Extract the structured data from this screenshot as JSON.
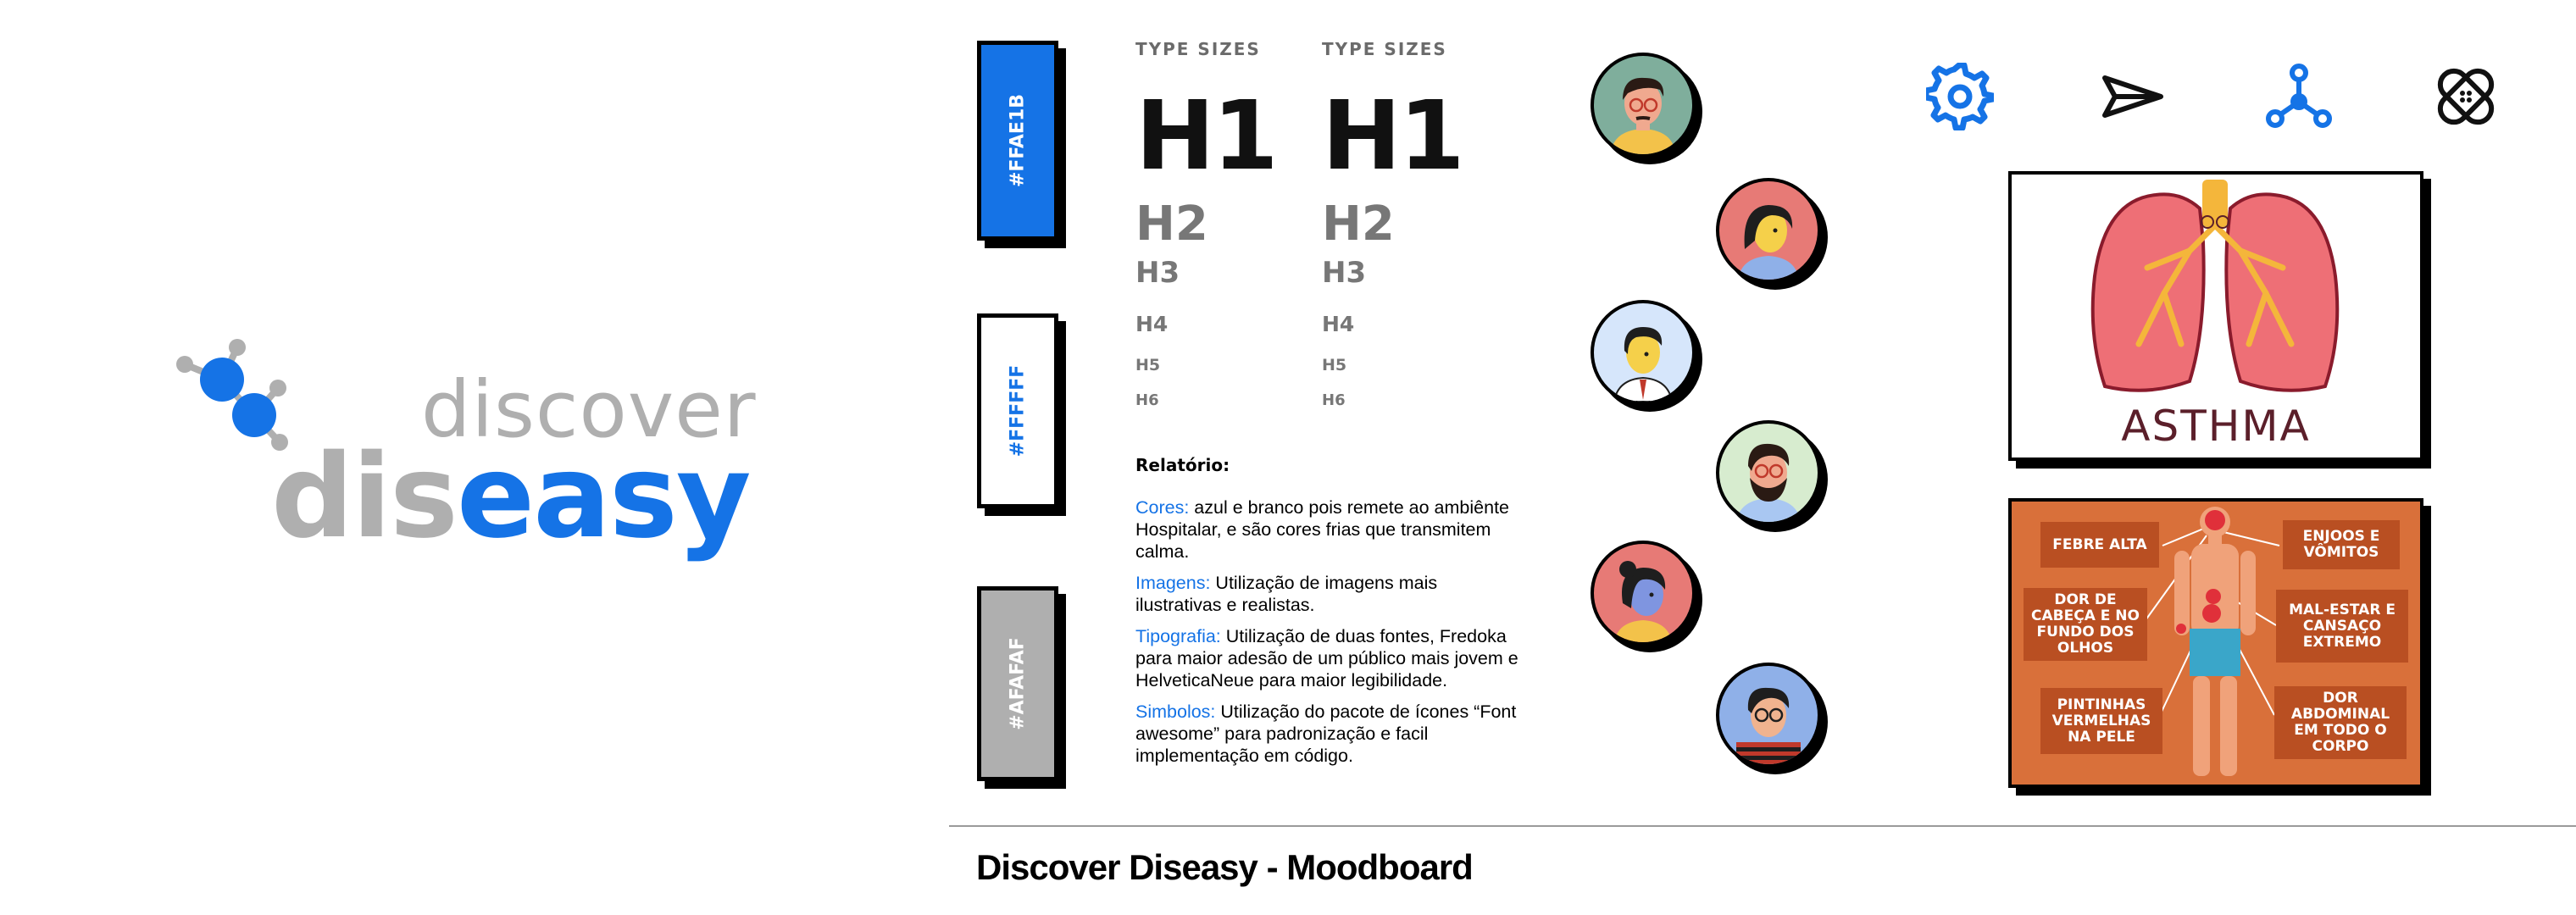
{
  "logo": {
    "top_word": "discover",
    "word_part1": "dis",
    "word_part2": "easy"
  },
  "colors": {
    "blue": "#1573e6",
    "white": "#ffffff",
    "gray": "#afafaf",
    "card_orange": "#d9703a"
  },
  "swatches": [
    {
      "label": "#FFAE1B",
      "fill": "#1573e6"
    },
    {
      "label": "#FFFFFF",
      "fill": "#ffffff"
    },
    {
      "label": "#AFAFAF",
      "fill": "#afafaf"
    }
  ],
  "type_sizes": {
    "caption": "TYPE SIZES",
    "headings": [
      "H1",
      "H2",
      "H3",
      "H4",
      "H5",
      "H6"
    ]
  },
  "report": {
    "title": "Relatório:",
    "items": [
      {
        "key": "Cores:",
        "text": " azul e branco pois remete ao ambiênte Hospitalar, e são cores frias que transmitem calma."
      },
      {
        "key": "Imagens:",
        "text": " Utilização de imagens mais ilustrativas e realistas."
      },
      {
        "key": "Tipografia:",
        "text": " Utilização de duas fontes, Fredoka para maior adesão de um público mais jovem e HelveticaNeue para maior legibilidade."
      },
      {
        "key": "Simbolos:",
        "text": " Utilização do pacote de ícones “Font awesome” para padronização e facil implementação em código."
      }
    ]
  },
  "icons": [
    "gear-icon",
    "paper-plane-icon",
    "network-nodes-icon",
    "bandage-icon"
  ],
  "asthma_card": {
    "title": "ASTHMA"
  },
  "symptoms": {
    "fever": "FEBRE ALTA",
    "headache": "DOR DE CABEÇA E NO FUNDO DOS OLHOS",
    "spots": "PINTINHAS VERMELHAS NA PELE",
    "nausea": "ENJOOS E VÔMITOS",
    "malaise": "MAL-ESTAR E CANSAÇO EXTREMO",
    "abdominal": "DOR ABDOMINAL EM TODO O CORPO"
  },
  "footer": {
    "title": "Discover Diseasy - Moodboard"
  }
}
